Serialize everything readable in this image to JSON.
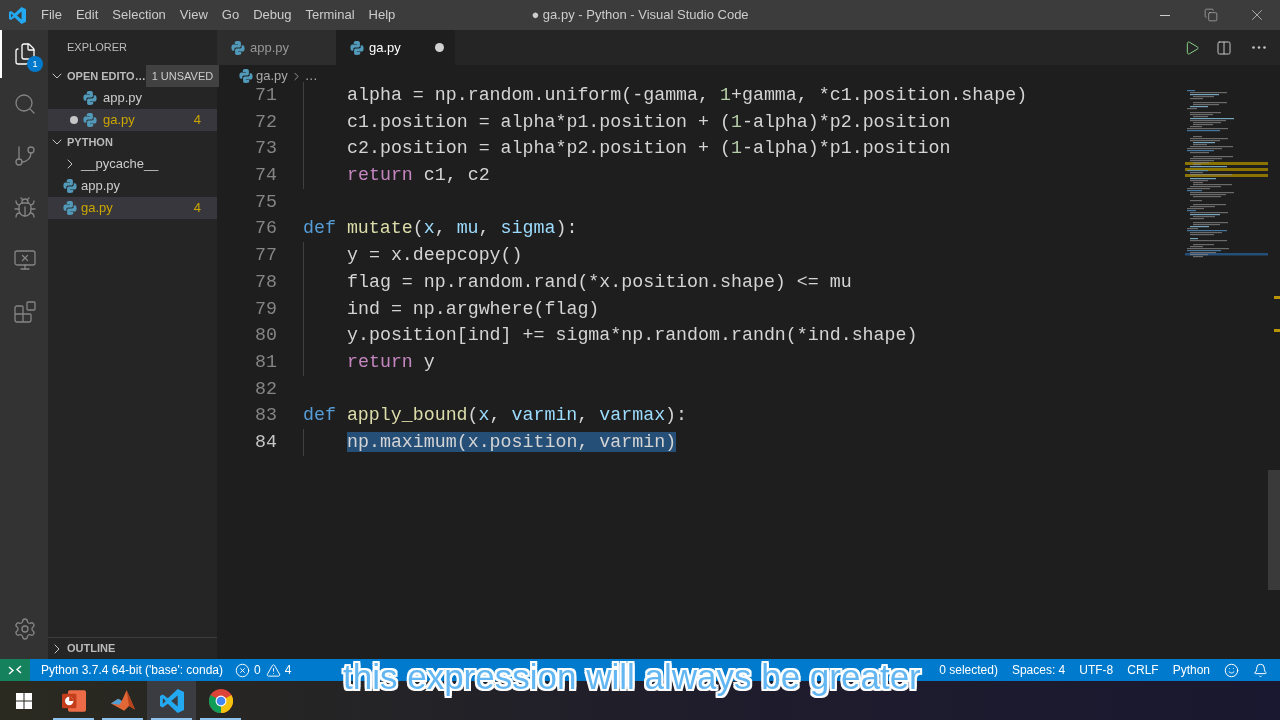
{
  "window": {
    "title": "● ga.py - Python - Visual Studio Code"
  },
  "menu": [
    "File",
    "Edit",
    "Selection",
    "View",
    "Go",
    "Debug",
    "Terminal",
    "Help"
  ],
  "activity_bar": [
    {
      "kind": "explorer",
      "selected": true,
      "badge": "1"
    },
    {
      "kind": "search",
      "selected": false
    },
    {
      "kind": "source_control",
      "selected": false
    },
    {
      "kind": "debug",
      "selected": false
    },
    {
      "kind": "remote",
      "selected": false
    },
    {
      "kind": "extensions",
      "selected": false
    },
    {
      "kind": "settings",
      "selected": false
    }
  ],
  "sidebar": {
    "title": "EXPLORER",
    "sections": [
      {
        "kind": "open_editors",
        "title": "OPEN EDITO…",
        "expanded": true,
        "badge": "1 UNSAVED",
        "items": [
          {
            "name": "app.py",
            "modified": false,
            "selected": false
          },
          {
            "name": "ga.py",
            "modified": true,
            "selected": true,
            "warnings": "4"
          }
        ]
      },
      {
        "kind": "folder",
        "title": "PYTHON",
        "expanded": true,
        "children": [
          {
            "kind": "folder",
            "name": "__pycache__",
            "expanded": false,
            "selected": false
          },
          {
            "kind": "file",
            "name": "app.py",
            "selected": false
          },
          {
            "kind": "file",
            "name": "ga.py",
            "selected": true,
            "warnings": "4"
          }
        ]
      },
      {
        "kind": "outline",
        "title": "OUTLINE",
        "expanded": false
      }
    ]
  },
  "tabs": [
    {
      "label": "app.py",
      "selected": false,
      "modified": false
    },
    {
      "label": "ga.py",
      "selected": true,
      "modified": true
    }
  ],
  "breadcrumb": [
    "ga.py",
    "…"
  ],
  "editor": {
    "lines": [
      {
        "number": "71",
        "selected": false,
        "indented": true,
        "tokens": [
          {
            "text": "alpha = np.random.uniform(-gamma, ",
            "kind": "plain"
          },
          {
            "text": "1",
            "kind": "number"
          },
          {
            "text": "+gamma, *c1.position.shape)",
            "kind": "plain"
          }
        ]
      },
      {
        "number": "72",
        "selected": false,
        "indented": true,
        "tokens": [
          {
            "text": "c1.position = alpha*p1.position + (",
            "kind": "plain"
          },
          {
            "text": "1",
            "kind": "number"
          },
          {
            "text": "-alpha)*p2.position",
            "kind": "plain"
          }
        ]
      },
      {
        "number": "73",
        "selected": false,
        "indented": true,
        "tokens": [
          {
            "text": "c2.position = alpha*p2.position + (",
            "kind": "plain"
          },
          {
            "text": "1",
            "kind": "number"
          },
          {
            "text": "-alpha)*p1.position",
            "kind": "plain"
          }
        ]
      },
      {
        "number": "74",
        "selected": false,
        "indented": true,
        "tokens": [
          {
            "text": "return",
            "kind": "control"
          },
          {
            "text": " c1, c2",
            "kind": "plain"
          }
        ]
      },
      {
        "number": "75",
        "selected": false
      },
      {
        "number": "76",
        "selected": false,
        "indented": false,
        "tokens": [
          {
            "text": "def",
            "kind": "keyword"
          },
          {
            "text": " mutate",
            "kind": "function"
          },
          {
            "text": "(",
            "kind": "plain"
          },
          {
            "text": "x",
            "kind": "param"
          },
          {
            "text": ", ",
            "kind": "plain"
          },
          {
            "text": "mu",
            "kind": "param"
          },
          {
            "text": ", ",
            "kind": "plain"
          },
          {
            "text": "sigma",
            "kind": "param"
          },
          {
            "text": "):",
            "kind": "plain"
          }
        ]
      },
      {
        "number": "77",
        "selected": false,
        "indented": true,
        "tokens": [
          {
            "text": "y = x.deepcopy()",
            "kind": "plain"
          }
        ]
      },
      {
        "number": "78",
        "selected": false,
        "indented": true,
        "tokens": [
          {
            "text": "flag = np.random.rand(*x.position.shape) <= mu",
            "kind": "plain"
          }
        ]
      },
      {
        "number": "79",
        "selected": false,
        "indented": true,
        "tokens": [
          {
            "text": "ind = np.argwhere(flag)",
            "kind": "plain"
          }
        ]
      },
      {
        "number": "80",
        "selected": false,
        "indented": true,
        "tokens": [
          {
            "text": "y.position[ind] += sigma*np.random.randn(*ind.shape)",
            "kind": "plain"
          }
        ]
      },
      {
        "number": "81",
        "selected": false,
        "indented": true,
        "tokens": [
          {
            "text": "return",
            "kind": "control"
          },
          {
            "text": " y",
            "kind": "plain"
          }
        ]
      },
      {
        "number": "82",
        "selected": false
      },
      {
        "number": "83",
        "selected": false,
        "indented": false,
        "tokens": [
          {
            "text": "def",
            "kind": "keyword"
          },
          {
            "text": " apply_bound",
            "kind": "function"
          },
          {
            "text": "(",
            "kind": "plain"
          },
          {
            "text": "x",
            "kind": "param"
          },
          {
            "text": ", ",
            "kind": "plain"
          },
          {
            "text": "varmin",
            "kind": "param"
          },
          {
            "text": ", ",
            "kind": "plain"
          },
          {
            "text": "varmax",
            "kind": "param"
          },
          {
            "text": "):",
            "kind": "plain"
          }
        ]
      },
      {
        "number": "84",
        "selected": true,
        "indented": true,
        "tokens": [
          {
            "text": "np.maximum(x.position, varmin)",
            "kind": "plain"
          }
        ]
      }
    ]
  },
  "status_bar": {
    "left": [
      {
        "kind": "interpreter",
        "text": "Python 3.7.4 64-bit ('base': conda)"
      },
      {
        "kind": "problems",
        "errors": "0",
        "warnings": "4"
      }
    ],
    "right": [
      {
        "kind": "text",
        "text": "0 selected)"
      },
      {
        "kind": "text",
        "text": "Spaces: 4"
      },
      {
        "kind": "text",
        "text": "UTF-8"
      },
      {
        "kind": "text",
        "text": "CRLF"
      },
      {
        "kind": "text",
        "text": "Python"
      },
      {
        "kind": "feedback"
      },
      {
        "kind": "notifications"
      }
    ]
  },
  "taskbar": {
    "apps": [
      {
        "kind": "presentation",
        "selected": false,
        "running": true
      },
      {
        "kind": "matlab",
        "selected": false,
        "running": true
      },
      {
        "kind": "vscode",
        "selected": true,
        "running": true
      },
      {
        "kind": "chrome",
        "selected": false,
        "running": true
      }
    ]
  },
  "subtitle": "this expression will always be greater"
}
